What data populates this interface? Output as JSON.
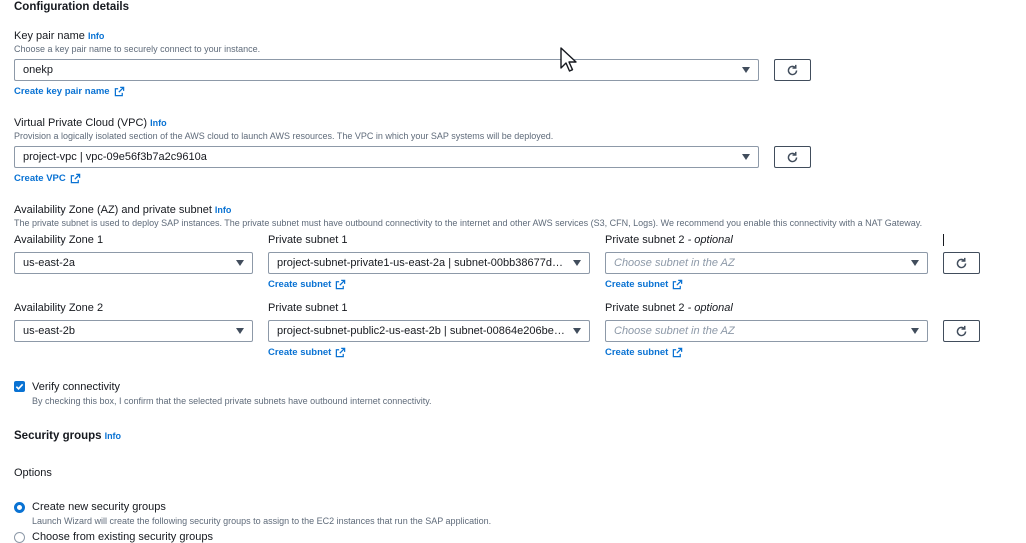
{
  "config": {
    "title": "Configuration details",
    "info": "Info",
    "keypair": {
      "label": "Key pair name",
      "description": "Choose a key pair name to securely connect to your instance.",
      "value": "onekp",
      "create_link": "Create key pair name"
    },
    "vpc": {
      "label": "Virtual Private Cloud (VPC)",
      "description": "Provision a logically isolated section of the AWS cloud to launch AWS resources. The VPC in which your SAP systems will be deployed.",
      "value": "project-vpc | vpc-09e56f3b7a2c9610a",
      "create_link": "Create VPC"
    },
    "az": {
      "label": "Availability Zone (AZ) and private subnet",
      "description": "The private subnet is used to deploy SAP instances. The private subnet must have outbound connectivity to the internet and other AWS services (S3, CFN, Logs). We recommend you enable this connectivity with a NAT Gateway.",
      "private_subnet_2_label": "Private subnet 2",
      "optional": "- optional",
      "create_subnet": "Create subnet",
      "rows": [
        {
          "az_label": "Availability Zone 1",
          "az_value": "us-east-2a",
          "subnet1_label": "Private subnet 1",
          "subnet1_value": "project-subnet-private1-us-east-2a | subnet-00bb38677d4...",
          "subnet2_placeholder": "Choose subnet in the AZ"
        },
        {
          "az_label": "Availability Zone 2",
          "az_value": "us-east-2b",
          "subnet1_label": "Private subnet 1",
          "subnet1_value": "project-subnet-public2-us-east-2b | subnet-00864e206be9...",
          "subnet2_placeholder": "Choose subnet in the AZ"
        }
      ]
    },
    "verify": {
      "label": "Verify connectivity",
      "description": "By checking this box, I confirm that the selected private subnets have outbound internet connectivity.",
      "checked": true
    },
    "security": {
      "title": "Security groups",
      "options_label": "Options",
      "create_new": {
        "label": "Create new security groups",
        "description": "Launch Wizard will create the following security groups to assign to the EC2 instances that run the SAP application.",
        "selected": true
      },
      "choose_existing": {
        "label": "Choose from existing security groups",
        "selected": false
      }
    }
  },
  "colors": {
    "link": "#0972d3",
    "text": "#16191f",
    "muted": "#5f6b7a",
    "border": "#8d99a8"
  },
  "icons": [
    "external-link-icon",
    "refresh-icon",
    "caret-down-icon",
    "checkmark-icon",
    "mouse-cursor-icon"
  ]
}
